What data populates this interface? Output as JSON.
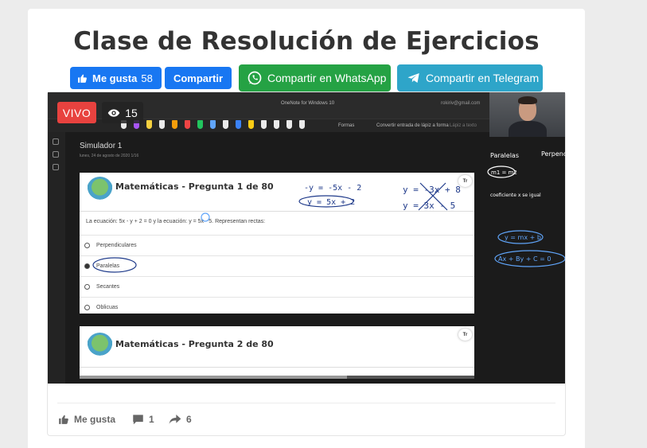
{
  "page": {
    "title": "Clase de Resolución de Ejercicios"
  },
  "share": {
    "fb_like_label": "Me gusta",
    "fb_like_count": "58",
    "fb_share_label": "Compartir",
    "whatsapp_label": "Compartir en WhatsApp",
    "telegram_label": "Compartir en Telegram",
    "colors": {
      "facebook": "#1877f2",
      "whatsapp": "#25a244",
      "telegram": "#2ea5c9"
    }
  },
  "video": {
    "live_badge": "VIVO",
    "viewer_count": "15",
    "window_title": "OneNote for Windows 10",
    "user_label": "rokiriv@gmail.com",
    "toolbar": {
      "shapes_label": "Formas",
      "ink_to_shape_label": "Convertir entrada de lápiz a forma",
      "ink_to_text_label": "Lápiz a texto"
    },
    "notebook_title": "Simulador 1",
    "notebook_date": "lunes, 24 de agosto de 2020     1/16",
    "questions": [
      {
        "title": "Matemáticas - Pregunta 1 de 80",
        "statement": "La ecuación: 5x - y + 2 = 0 y la ecuación: y = 5x - 5. Representan rectas:",
        "options": [
          "Perpendiculares",
          "Paralelas",
          "Secantes",
          "Oblicuas"
        ],
        "selected": "Paralelas"
      },
      {
        "title": "Matemáticas - Pregunta 2 de 80"
      }
    ],
    "handwritten": {
      "eq1": "-y = -5x - 2",
      "eq1b": "y = 5x + 2",
      "eq2": "y = -3x + 8",
      "eq2b": "y = 3x - 5",
      "side_title": "Paralelas",
      "side_title2": "Perpendi",
      "side_m": "m1 = m2",
      "side_note": "coeficiente x se igual",
      "side_form": "y = mx + b",
      "side_general": "Ax + By + C = 0"
    }
  },
  "actions": {
    "like_label": "Me gusta",
    "comment_count": "1",
    "share_count": "6"
  }
}
